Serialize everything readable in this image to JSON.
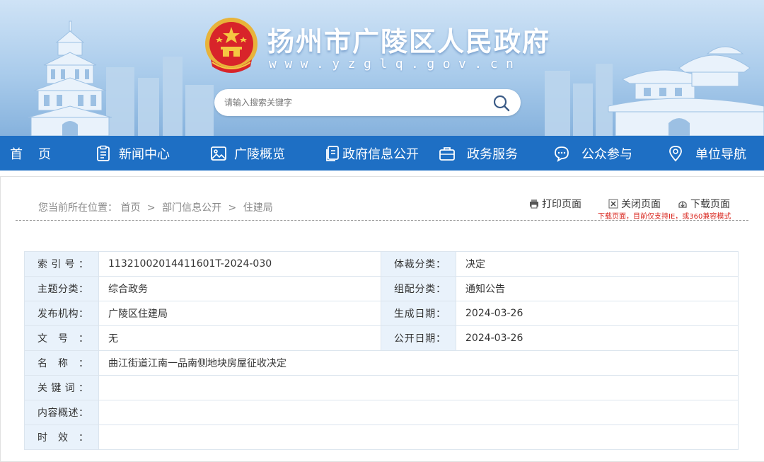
{
  "site": {
    "title": "扬州市广陵区人民政府",
    "url": "www.yzglq.gov.cn",
    "search_placeholder": "请输入搜索关键字"
  },
  "nav": {
    "items": [
      {
        "label": "首页",
        "icon": "home-icon"
      },
      {
        "label": "新闻中心",
        "icon": "clipboard-icon"
      },
      {
        "label": "广陵概览",
        "icon": "image-icon"
      },
      {
        "label": "政府信息公开",
        "icon": "document-icon"
      },
      {
        "label": "政务服务",
        "icon": "briefcase-icon"
      },
      {
        "label": "公众参与",
        "icon": "chat-icon"
      },
      {
        "label": "单位导航",
        "icon": "location-pin-icon"
      }
    ]
  },
  "breadcrumb": {
    "prefix": "您当前所在位置：",
    "items": [
      "首页",
      "部门信息公开",
      "住建局"
    ],
    "separator": ">"
  },
  "tools": {
    "print": "打印页面",
    "close": "关闭页面",
    "download": "下载页面",
    "note": "下载页面，目前仅支持IE，或360兼容模式"
  },
  "meta": {
    "index_label": "索引号：",
    "index_value": "11321002014411601T-2024-030",
    "genre_label": "体裁分类：",
    "genre_value": "决定",
    "topic_label": "主题分类：",
    "topic_value": "综合政务",
    "group_label": "组配分类：",
    "group_value": "通知公告",
    "publisher_label": "发布机构：",
    "publisher_value": "广陵区住建局",
    "created_label": "生成日期：",
    "created_value": "2024-03-26",
    "docno_label": "文号：",
    "docno_value": "无",
    "published_label": "公开日期：",
    "published_value": "2024-03-26",
    "name_label": "名称：",
    "name_value": "曲江街道江南一品南侧地块房屋征收决定",
    "keywords_label": "关键词：",
    "keywords_value": "",
    "summary_label": "内容概述：",
    "summary_value": "",
    "validity_label": "时效：",
    "validity_value": ""
  },
  "colors": {
    "nav_bg": "#1e6fc4",
    "label_bg": "#e9f2fb",
    "note_red": "#d9251d"
  }
}
